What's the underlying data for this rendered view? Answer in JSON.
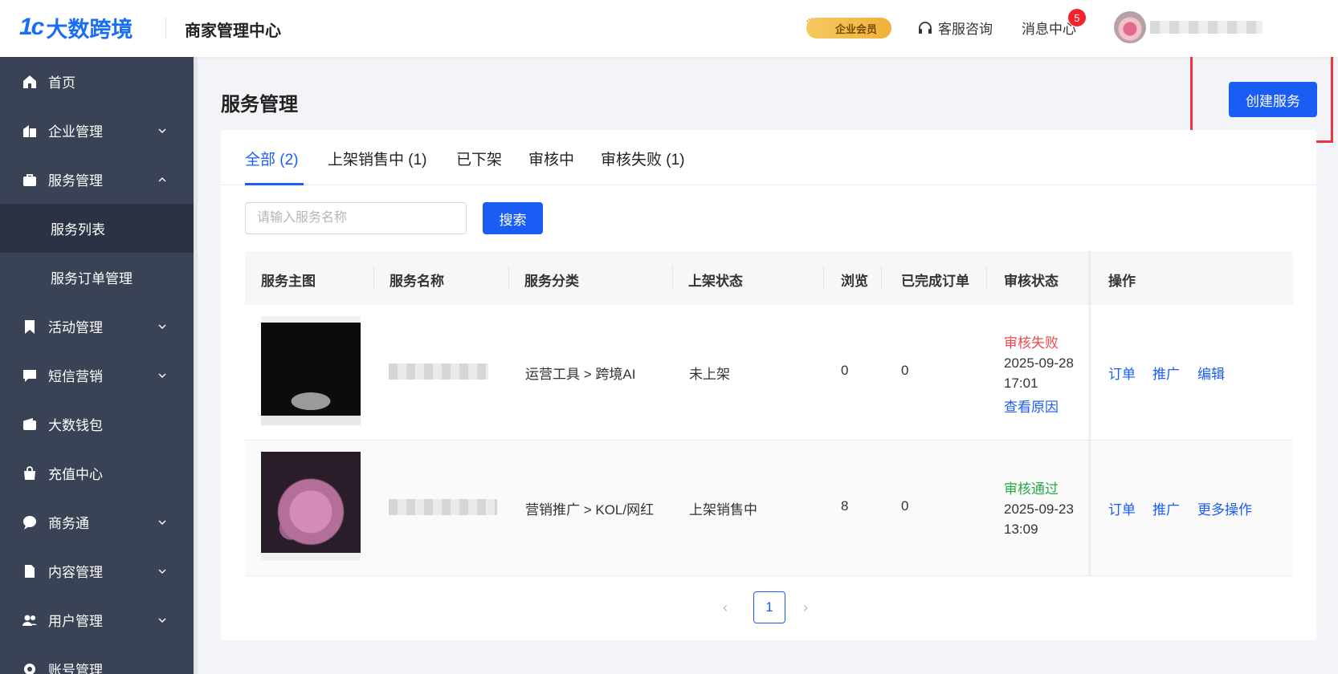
{
  "header": {
    "logo_mark": "1c",
    "logo_text": "大数跨境",
    "app_title": "商家管理中心",
    "vip_label": "企业会员",
    "customer_service": "客服咨询",
    "message_center": "消息中心",
    "message_count": "5"
  },
  "sidebar": {
    "items": [
      {
        "label": "首页",
        "icon": "home-icon"
      },
      {
        "label": "企业管理",
        "icon": "building-icon"
      },
      {
        "label": "服务管理",
        "icon": "briefcase-icon"
      },
      {
        "label": "服务列表"
      },
      {
        "label": "服务订单管理"
      },
      {
        "label": "活动管理",
        "icon": "bookmark-icon"
      },
      {
        "label": "短信营销",
        "icon": "message-icon"
      },
      {
        "label": "大数钱包",
        "icon": "wallet-icon"
      },
      {
        "label": "充值中心",
        "icon": "bag-icon"
      },
      {
        "label": "商务通",
        "icon": "chat-icon"
      },
      {
        "label": "内容管理",
        "icon": "document-icon"
      },
      {
        "label": "用户管理",
        "icon": "users-icon"
      },
      {
        "label": "账号管理",
        "icon": "gear-icon"
      }
    ]
  },
  "main": {
    "title": "服务管理",
    "create_button": "创建服务",
    "tabs": [
      "全部 (2)",
      "上架销售中 (1)",
      "已下架",
      "审核中",
      "审核失败 (1)"
    ],
    "search": {
      "placeholder": "请输入服务名称",
      "button": "搜索"
    },
    "table": {
      "columns": [
        "服务主图",
        "服务名称",
        "服务分类",
        "上架状态",
        "浏览",
        "已完成订单",
        "审核状态",
        "操作"
      ],
      "rows": [
        {
          "category": "运营工具 > 跨境AI",
          "listing_status": "未上架",
          "views": "0",
          "completed_orders": "0",
          "review_status": "审核失败",
          "review_date": "2025-09-28",
          "review_time": "17:01",
          "review_link": "查看原因",
          "actions": [
            "订单",
            "推广",
            "编辑"
          ]
        },
        {
          "category": "营销推广 > KOL/网红",
          "listing_status": "上架销售中",
          "views": "8",
          "completed_orders": "0",
          "review_status": "审核通过",
          "review_date": "2025-09-23",
          "review_time": "13:09",
          "actions": [
            "订单",
            "推广",
            "更多操作"
          ]
        }
      ]
    },
    "pagination": {
      "current": "1",
      "prev": "‹",
      "next": "›"
    }
  },
  "colors": {
    "accent": "#1a5df5",
    "sidebar": "#3a4356",
    "fail": "#f0474e",
    "pass": "#29a84b",
    "highlight": "#f0333f"
  }
}
